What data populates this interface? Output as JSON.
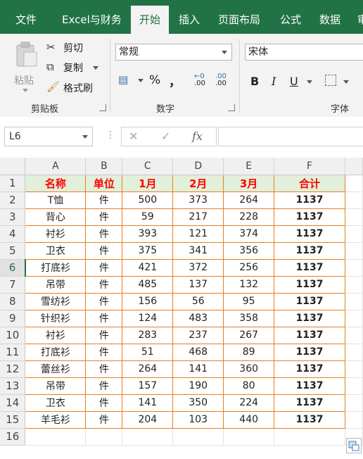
{
  "ribbon_tabs": [
    "文件",
    "Excel与财务",
    "开始",
    "插入",
    "页面布局",
    "公式",
    "数据",
    "审"
  ],
  "active_tab_index": 2,
  "clipboard": {
    "paste_label": "粘贴",
    "cut_label": "剪切",
    "copy_label": "复制",
    "format_painter_label": "格式刷",
    "group_label": "剪贴板"
  },
  "number": {
    "format_value": "常规",
    "percent_symbol": "%",
    "comma_symbol": "，",
    "inc_decimal": ".00",
    "dec_decimal": ".00",
    "group_label": "数字"
  },
  "font": {
    "font_name": "宋体",
    "bold": "B",
    "italic": "I",
    "underline": "U",
    "group_label": "字体"
  },
  "formula_bar": {
    "name_box": "L6",
    "cancel": "✕",
    "enter": "✓",
    "fx": "fx",
    "formula": ""
  },
  "columns": [
    "A",
    "B",
    "C",
    "D",
    "E",
    "F"
  ],
  "header_row": [
    "名称",
    "单位",
    "1月",
    "2月",
    "3月",
    "合计"
  ],
  "rows": [
    [
      "T恤",
      "件",
      "500",
      "373",
      "264",
      "1137"
    ],
    [
      "背心",
      "件",
      "59",
      "217",
      "228",
      "1137"
    ],
    [
      "衬衫",
      "件",
      "393",
      "121",
      "374",
      "1137"
    ],
    [
      "卫衣",
      "件",
      "375",
      "341",
      "356",
      "1137"
    ],
    [
      "打底衫",
      "件",
      "421",
      "372",
      "256",
      "1137"
    ],
    [
      "吊带",
      "件",
      "485",
      "137",
      "132",
      "1137"
    ],
    [
      "雪纺衫",
      "件",
      "156",
      "56",
      "95",
      "1137"
    ],
    [
      "针织衫",
      "件",
      "124",
      "483",
      "358",
      "1137"
    ],
    [
      "衬衫",
      "件",
      "283",
      "237",
      "267",
      "1137"
    ],
    [
      "打底衫",
      "件",
      "51",
      "468",
      "89",
      "1137"
    ],
    [
      "蕾丝衫",
      "件",
      "264",
      "141",
      "360",
      "1137"
    ],
    [
      "吊带",
      "件",
      "157",
      "190",
      "80",
      "1137"
    ],
    [
      "卫衣",
      "件",
      "141",
      "350",
      "224",
      "1137"
    ],
    [
      "羊毛衫",
      "件",
      "204",
      "103",
      "440",
      "1137"
    ]
  ],
  "row_numbers": [
    "1",
    "2",
    "3",
    "4",
    "5",
    "6",
    "7",
    "8",
    "9",
    "10",
    "11",
    "12",
    "13",
    "14",
    "15",
    "16"
  ],
  "active_row": "6",
  "colors": {
    "brand": "#217346",
    "header_fill": "#e2efda",
    "header_text": "#ff0000",
    "border": "#e67e22"
  }
}
